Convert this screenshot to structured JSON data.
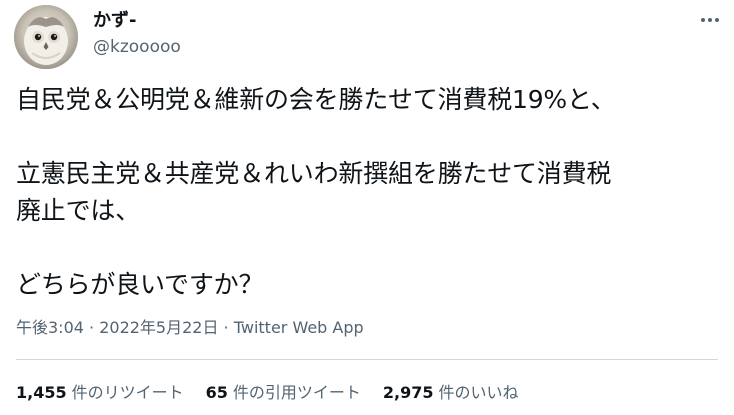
{
  "author": {
    "display_name": "かず-",
    "handle": "@kzooooo",
    "avatar_icon": "owl-avatar-icon"
  },
  "more_icon": "more-dots-icon",
  "tweet": {
    "lines": [
      "自民党＆公明党＆維新の会を勝たせて消費税19%と、",
      "",
      "立憲民主党＆共産党＆れいわ新撰組を勝たせて消費税",
      "廃止では、",
      "",
      "どちらが良いですか？"
    ]
  },
  "meta": {
    "time": "午後3:04",
    "separator_1": " · ",
    "date": "2022年5月22日",
    "separator_2": " · ",
    "source": "Twitter Web App"
  },
  "stats": {
    "retweets": {
      "count": "1,455",
      "label": "件のリツイート"
    },
    "quotes": {
      "count": "65",
      "label": "件の引用ツイート"
    },
    "likes": {
      "count": "2,975",
      "label": "件のいいね"
    }
  },
  "colors": {
    "text_primary": "#0f1419",
    "text_secondary": "#536471",
    "divider": "#cfd9de"
  }
}
